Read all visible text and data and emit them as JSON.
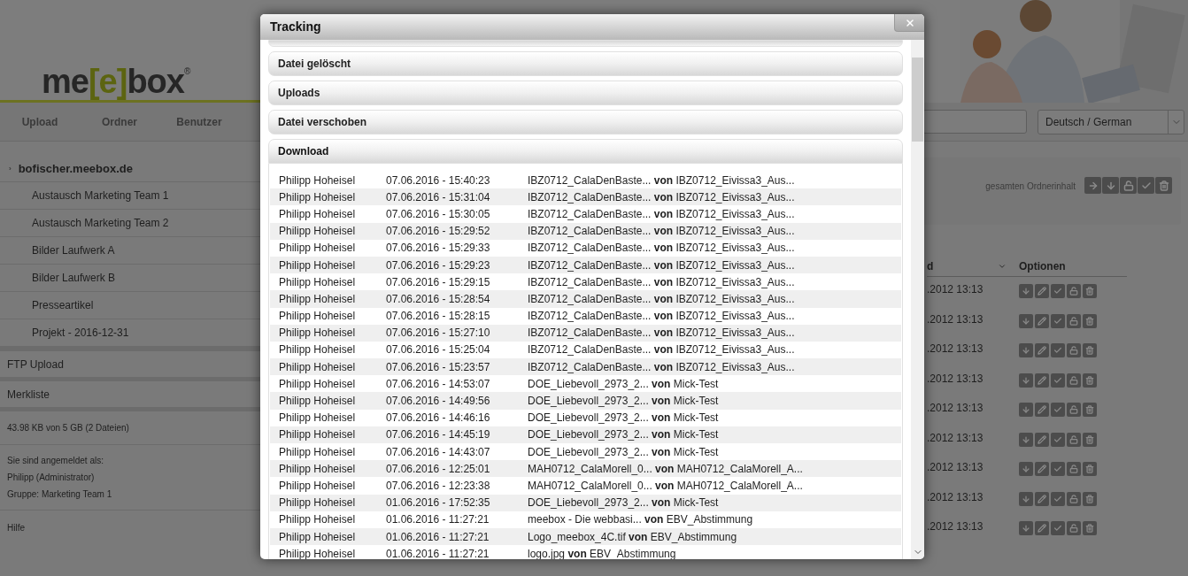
{
  "header": {
    "logo": {
      "parts": [
        "me",
        "[e]",
        "box"
      ],
      "mark": "®"
    },
    "nav": [
      "Upload",
      "Ordner",
      "Benutzer"
    ],
    "language_select": {
      "value": "Deutsch / German"
    }
  },
  "sidebar": {
    "root_marker": "›",
    "root": "bofischer.meebox.de",
    "folders": [
      "Austausch Marketing Team 1",
      "Austausch Marketing Team 2",
      "Bilder Laufwerk A",
      "Bilder Laufwerk B",
      "Presseartikel",
      "Projekt - 2016-12-31"
    ],
    "sections": [
      "FTP Upload",
      "Merkliste"
    ],
    "storage": "43.98 KB von 5 GB (2 Dateien)",
    "login": [
      "Sie sind angemeldet als:",
      "Philipp (Administrator)",
      "Gruppe: Marketing Team 1"
    ],
    "help": "Hilfe"
  },
  "content": {
    "folder_actions_label": "gesamten Ordnerinhalt",
    "columns": [
      "d",
      "Optionen"
    ],
    "rows": [
      ".2012 13:13",
      ".2012 13:13",
      ".2012 13:13",
      ".2012 13:13",
      ".2012 13:13",
      ".2012 13:13",
      ".2012 13:13",
      ".2012 13:13",
      ".2012 13:13"
    ]
  },
  "dialog": {
    "title": "Tracking",
    "sections": [
      {
        "label": "Datei gelöscht",
        "expanded": false
      },
      {
        "label": "Uploads",
        "expanded": false
      },
      {
        "label": "Datei verschoben",
        "expanded": false
      },
      {
        "label": "Download",
        "expanded": true
      }
    ],
    "entries": [
      {
        "user": "Philipp Hoheisel",
        "time": "07.06.2016 - 15:40:23",
        "item": "IBZ0712_CalaDenBaste... **von** IBZ0712_Eivissa3_Aus..."
      },
      {
        "user": "Philipp Hoheisel",
        "time": "07.06.2016 - 15:31:04",
        "item": "IBZ0712_CalaDenBaste... **von** IBZ0712_Eivissa3_Aus..."
      },
      {
        "user": "Philipp Hoheisel",
        "time": "07.06.2016 - 15:30:05",
        "item": "IBZ0712_CalaDenBaste... **von** IBZ0712_Eivissa3_Aus..."
      },
      {
        "user": "Philipp Hoheisel",
        "time": "07.06.2016 - 15:29:52",
        "item": "IBZ0712_CalaDenBaste... **von** IBZ0712_Eivissa3_Aus..."
      },
      {
        "user": "Philipp Hoheisel",
        "time": "07.06.2016 - 15:29:33",
        "item": "IBZ0712_CalaDenBaste... **von** IBZ0712_Eivissa3_Aus..."
      },
      {
        "user": "Philipp Hoheisel",
        "time": "07.06.2016 - 15:29:23",
        "item": "IBZ0712_CalaDenBaste... **von** IBZ0712_Eivissa3_Aus..."
      },
      {
        "user": "Philipp Hoheisel",
        "time": "07.06.2016 - 15:29:15",
        "item": "IBZ0712_CalaDenBaste... **von** IBZ0712_Eivissa3_Aus..."
      },
      {
        "user": "Philipp Hoheisel",
        "time": "07.06.2016 - 15:28:54",
        "item": "IBZ0712_CalaDenBaste... **von** IBZ0712_Eivissa3_Aus..."
      },
      {
        "user": "Philipp Hoheisel",
        "time": "07.06.2016 - 15:28:15",
        "item": "IBZ0712_CalaDenBaste... **von** IBZ0712_Eivissa3_Aus..."
      },
      {
        "user": "Philipp Hoheisel",
        "time": "07.06.2016 - 15:27:10",
        "item": "IBZ0712_CalaDenBaste... **von** IBZ0712_Eivissa3_Aus..."
      },
      {
        "user": "Philipp Hoheisel",
        "time": "07.06.2016 - 15:25:04",
        "item": "IBZ0712_CalaDenBaste... **von** IBZ0712_Eivissa3_Aus..."
      },
      {
        "user": "Philipp Hoheisel",
        "time": "07.06.2016 - 15:23:57",
        "item": "IBZ0712_CalaDenBaste... **von** IBZ0712_Eivissa3_Aus..."
      },
      {
        "user": "Philipp Hoheisel",
        "time": "07.06.2016 - 14:53:07",
        "item": "DOE_Liebevoll_2973_2... **von** Mick-Test"
      },
      {
        "user": "Philipp Hoheisel",
        "time": "07.06.2016 - 14:49:56",
        "item": "DOE_Liebevoll_2973_2... **von** Mick-Test"
      },
      {
        "user": "Philipp Hoheisel",
        "time": "07.06.2016 - 14:46:16",
        "item": "DOE_Liebevoll_2973_2... **von** Mick-Test"
      },
      {
        "user": "Philipp Hoheisel",
        "time": "07.06.2016 - 14:45:19",
        "item": "DOE_Liebevoll_2973_2... **von** Mick-Test"
      },
      {
        "user": "Philipp Hoheisel",
        "time": "07.06.2016 - 14:43:07",
        "item": "DOE_Liebevoll_2973_2... **von** Mick-Test"
      },
      {
        "user": "Philipp Hoheisel",
        "time": "07.06.2016 - 12:25:01",
        "item": "MAH0712_CalaMorell_0... **von** MAH0712_CalaMorell_A..."
      },
      {
        "user": "Philipp Hoheisel",
        "time": "07.06.2016 - 12:23:38",
        "item": "MAH0712_CalaMorell_0... **von** MAH0712_CalaMorell_A..."
      },
      {
        "user": "Philipp Hoheisel",
        "time": "01.06.2016 - 17:52:35",
        "item": "DOE_Liebevoll_2973_2... **von** Mick-Test"
      },
      {
        "user": "Philipp Hoheisel",
        "time": "01.06.2016 - 11:27:21",
        "item": "meebox - Die webbasi... **von** EBV_Abstimmung"
      },
      {
        "user": "Philipp Hoheisel",
        "time": "01.06.2016 - 11:27:21",
        "item": "Logo_meebox_4C.tif **von** EBV_Abstimmung"
      },
      {
        "user": "Philipp Hoheisel",
        "time": "01.06.2016 - 11:27:21",
        "item": "logo.jpg **von** EBV_Abstimmung"
      }
    ]
  }
}
